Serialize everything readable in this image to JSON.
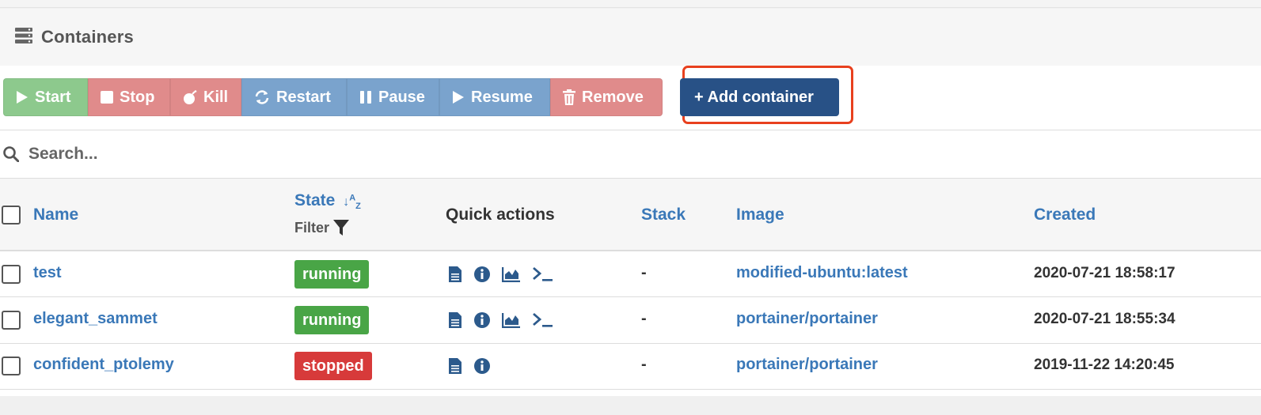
{
  "panel": {
    "title": "Containers"
  },
  "toolbar": {
    "start": "Start",
    "stop": "Stop",
    "kill": "Kill",
    "restart": "Restart",
    "pause": "Pause",
    "resume": "Resume",
    "remove": "Remove",
    "add_container": "+ Add container"
  },
  "search": {
    "placeholder": "Search..."
  },
  "table": {
    "headers": {
      "name": "Name",
      "state": "State",
      "state_filter": "Filter",
      "quick_actions": "Quick actions",
      "stack": "Stack",
      "image": "Image",
      "created": "Created"
    },
    "rows": [
      {
        "name": "test",
        "state": "running",
        "stack": "-",
        "image": "modified-ubuntu:latest",
        "created": "2020-07-21 18:58:17",
        "actions": [
          "logs-icon",
          "inspect-icon",
          "stats-icon",
          "console-icon"
        ]
      },
      {
        "name": "elegant_sammet",
        "state": "running",
        "stack": "-",
        "image": "portainer/portainer",
        "created": "2020-07-21 18:55:34",
        "actions": [
          "logs-icon",
          "inspect-icon",
          "stats-icon",
          "console-icon"
        ]
      },
      {
        "name": "confident_ptolemy",
        "state": "stopped",
        "stack": "-",
        "image": "portainer/portainer",
        "created": "2019-11-22 14:20:45",
        "actions": [
          "logs-icon",
          "inspect-icon"
        ]
      }
    ]
  },
  "colors": {
    "link": "#3a78b8",
    "running": "#49a546",
    "stopped": "#d73a3a",
    "add_button": "#285186",
    "highlight": "#e8401e"
  }
}
